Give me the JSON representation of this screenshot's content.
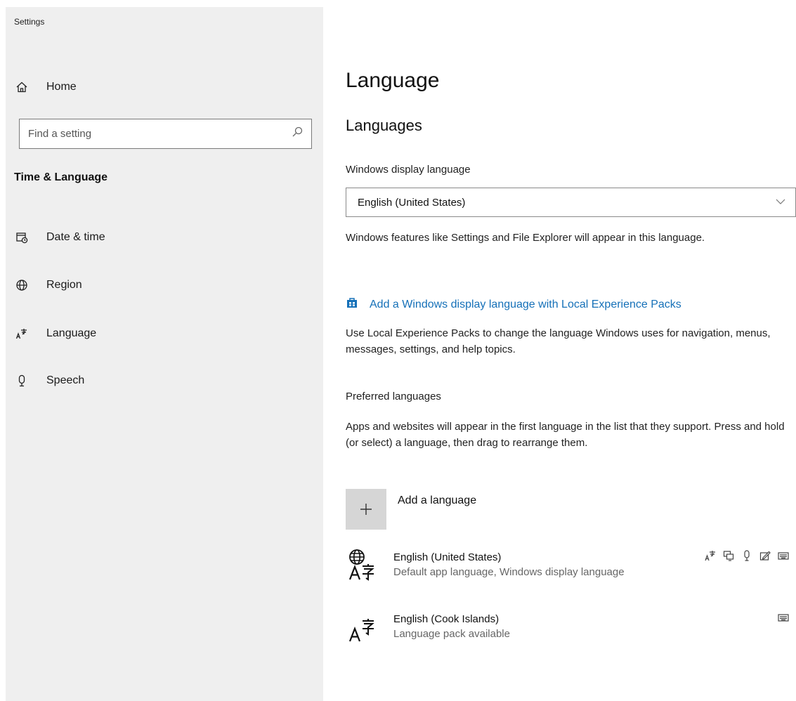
{
  "window": {
    "title": "Settings"
  },
  "sidebar": {
    "home_label": "Home",
    "search_placeholder": "Find a setting",
    "section_title": "Time & Language",
    "items": [
      {
        "label": "Date & time",
        "icon": "calendar-clock-icon"
      },
      {
        "label": "Region",
        "icon": "globe-icon"
      },
      {
        "label": "Language",
        "icon": "language-icon"
      },
      {
        "label": "Speech",
        "icon": "microphone-icon"
      }
    ]
  },
  "main": {
    "page_title": "Language",
    "languages_heading": "Languages",
    "display_language": {
      "label": "Windows display language",
      "selected": "English (United States)",
      "description": "Windows features like Settings and File Explorer will appear in this language."
    },
    "lxp_link": {
      "label": "Add a Windows display language with Local Experience Packs",
      "icon": "store-icon",
      "description": "Use Local Experience Packs to change the language Windows uses for navigation, menus, messages, settings, and help topics."
    },
    "preferred": {
      "label": "Preferred languages",
      "description": "Apps and websites will appear in the first language in the list that they support. Press and hold (or select) a language, then drag to rearrange them.",
      "add_label": "Add a language",
      "languages": [
        {
          "name": "English (United States)",
          "status": "Default app language, Windows display language",
          "features": [
            "language-pack-icon",
            "display-icon",
            "speech-icon",
            "handwriting-icon",
            "keyboard-icon"
          ]
        },
        {
          "name": "English (Cook Islands)",
          "status": "Language pack available",
          "features": [
            "keyboard-icon"
          ]
        }
      ]
    }
  },
  "colors": {
    "sidebar_bg": "#efefef",
    "link": "#1570b8",
    "add_button_bg": "#d6d6d6"
  }
}
